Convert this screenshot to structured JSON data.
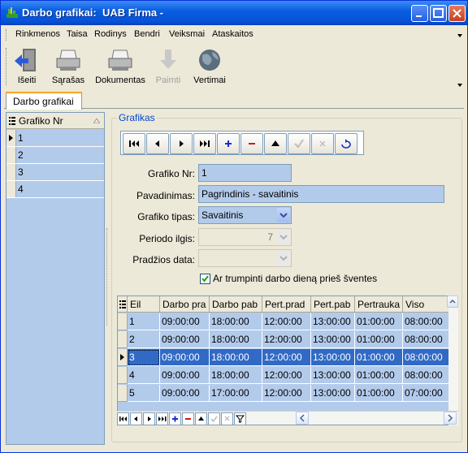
{
  "window": {
    "title": "Darbo grafikai:  UAB Firma -"
  },
  "menu": [
    "Rinkmenos",
    "Taisa",
    "Rodinys",
    "Bendri",
    "Veiksmai",
    "Ataskaitos"
  ],
  "toolbar": [
    {
      "label": "Išeiti",
      "icon": "exit-door-icon",
      "enabled": true
    },
    {
      "label": "Sąrašas",
      "icon": "printer-icon",
      "enabled": true
    },
    {
      "label": "Dokumentas",
      "icon": "printer-icon",
      "enabled": true
    },
    {
      "label": "Paimti",
      "icon": "arrow-down-icon",
      "enabled": false
    },
    {
      "label": "Vertimai",
      "icon": "globe-icon",
      "enabled": true
    }
  ],
  "tab": {
    "label": "Darbo grafikai"
  },
  "left_grid": {
    "header": "Grafiko Nr",
    "rows": [
      "1",
      "2",
      "3",
      "4"
    ],
    "current_row": 0
  },
  "form": {
    "group_title": "Grafikas",
    "nav_buttons": [
      "first",
      "prior",
      "next",
      "last",
      "insert",
      "delete",
      "edit",
      "post",
      "cancel",
      "refresh"
    ],
    "fields": {
      "grafiko_nr": {
        "label": "Grafiko Nr:",
        "value": "1"
      },
      "pavadinimas": {
        "label": "Pavadinimas:",
        "value": "Pagrindinis - savaitinis"
      },
      "grafiko_tipas": {
        "label": "Grafiko tipas:",
        "value": "Savaitinis"
      },
      "periodo_ilgis": {
        "label": "Periodo ilgis:",
        "value": "7"
      },
      "pradzios_data": {
        "label": "Pradžios data:",
        "value": ""
      }
    },
    "checkbox": {
      "label": "Ar trumpinti darbo dieną prieš šventes",
      "checked": true
    }
  },
  "detail_grid": {
    "columns": [
      "Eil",
      "Darbo pra",
      "Darbo pab",
      "Pert.prad",
      "Pert.pab",
      "Pertrauka",
      "Viso"
    ],
    "rows": [
      [
        "1",
        "09:00:00",
        "18:00:00",
        "12:00:00",
        "13:00:00",
        "01:00:00",
        "08:00:00"
      ],
      [
        "2",
        "09:00:00",
        "18:00:00",
        "12:00:00",
        "13:00:00",
        "01:00:00",
        "08:00:00"
      ],
      [
        "3",
        "09:00:00",
        "18:00:00",
        "12:00:00",
        "13:00:00",
        "01:00:00",
        "08:00:00"
      ],
      [
        "4",
        "09:00:00",
        "18:00:00",
        "12:00:00",
        "13:00:00",
        "01:00:00",
        "08:00:00"
      ],
      [
        "5",
        "09:00:00",
        "17:00:00",
        "12:00:00",
        "13:00:00",
        "01:00:00",
        "07:00:00"
      ]
    ],
    "selected_row": 2
  },
  "colors": {
    "grid_bg": "#B3CBEB",
    "selection": "#316AC5",
    "title_bar": "#0A5EE0",
    "group_title": "#0046D5"
  }
}
